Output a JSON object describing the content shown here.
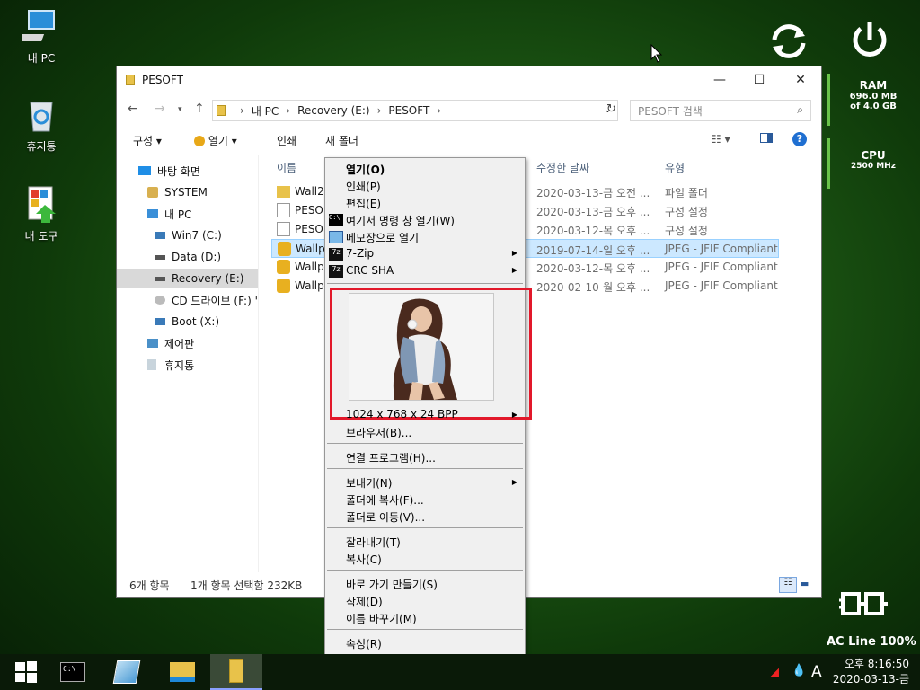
{
  "desktop": {
    "icons": [
      {
        "label": "내 PC",
        "icon": "monitor-icon"
      },
      {
        "label": "휴지통",
        "icon": "recycle-bin-icon"
      },
      {
        "label": "내 도구",
        "icon": "tools-icon"
      }
    ]
  },
  "widgets": {
    "ram": {
      "label": "RAM",
      "used": "696.0 MB",
      "total": "of 4.0 GB"
    },
    "cpu": {
      "label": "CPU",
      "speed": "2500 MHz"
    },
    "power": {
      "status": "AC Line 100%"
    }
  },
  "explorer": {
    "title": "PESOFT",
    "breadcrumb": [
      "내 PC",
      "Recovery (E:)",
      "PESOFT"
    ],
    "search_placeholder": "PESOFT 검색",
    "commands": {
      "organize": "구성",
      "open": "열기",
      "print": "인쇄",
      "new_folder": "새 폴더"
    },
    "nav_items": [
      {
        "label": "바탕 화면",
        "icon": "desktop-icon"
      },
      {
        "label": "SYSTEM",
        "icon": "user-folder-icon"
      },
      {
        "label": "내 PC",
        "icon": "computer-icon"
      },
      {
        "label": "Win7 (C:)",
        "icon": "drive-icon"
      },
      {
        "label": "Data (D:)",
        "icon": "drive-icon"
      },
      {
        "label": "Recovery (E:)",
        "icon": "drive-icon",
        "selected": true
      },
      {
        "label": "CD 드라이브 (F:) '",
        "icon": "cd-drive-icon"
      },
      {
        "label": "Boot (X:)",
        "icon": "drive-icon"
      },
      {
        "label": "제어판",
        "icon": "control-panel-icon"
      },
      {
        "label": "휴지통",
        "icon": "recycle-bin-icon"
      }
    ],
    "columns": {
      "name": "이름",
      "date": "수정한 날짜",
      "type": "유형"
    },
    "files": [
      {
        "name": "Wall2",
        "date": "2020-03-13-금 오전 ...",
        "type": "파일 폴더",
        "icon": "folder-icon"
      },
      {
        "name": "PESOF",
        "date": "2020-03-13-금 오후 ...",
        "type": "구성 설정",
        "icon": "config-file-icon"
      },
      {
        "name": "PESOF",
        "date": "2020-03-12-목 오후 ...",
        "type": "구성 설정",
        "icon": "config-file-icon"
      },
      {
        "name": "Wallpa",
        "date": "2019-07-14-일 오후 ...",
        "type": "JPEG - JFIF Compliant",
        "icon": "jpeg-icon",
        "selected": true
      },
      {
        "name": "Wallpa",
        "date": "2020-03-12-목 오후 ...",
        "type": "JPEG - JFIF Compliant",
        "icon": "jpeg-icon"
      },
      {
        "name": "Wallpa",
        "date": "2020-02-10-월 오후 ...",
        "type": "JPEG - JFIF Compliant",
        "icon": "jpeg-icon"
      }
    ],
    "status": {
      "count": "6개 항목",
      "selection": "1개 항목 선택함 232KB"
    }
  },
  "context_menu": {
    "open": "열기(O)",
    "print": "인쇄(P)",
    "edit": "편집(E)",
    "cmd_here": "여기서 명령 창 열기(W)",
    "notepad": "메모장으로 열기",
    "zip": "7-Zip",
    "crc": "CRC SHA",
    "image_info": "1024 x 768 x 24 BPP",
    "browser": "브라우저(B)...",
    "open_with": "연결 프로그램(H)...",
    "send_to": "보내기(N)",
    "copy_to": "폴더에 복사(F)...",
    "move_to": "폴더로 이동(V)...",
    "cut": "잘라내기(T)",
    "copy": "복사(C)",
    "shortcut": "바로 가기 만들기(S)",
    "delete": "삭제(D)",
    "rename": "이름 바꾸기(M)",
    "properties": "속성(R)"
  },
  "taskbar": {
    "ime": "A",
    "time": "오후 8:16:50",
    "date": "2020-03-13-금"
  },
  "colors": {
    "accent_red": "#e2182a",
    "selection": "#cce8ff",
    "taskbar": "#0a1a08"
  }
}
